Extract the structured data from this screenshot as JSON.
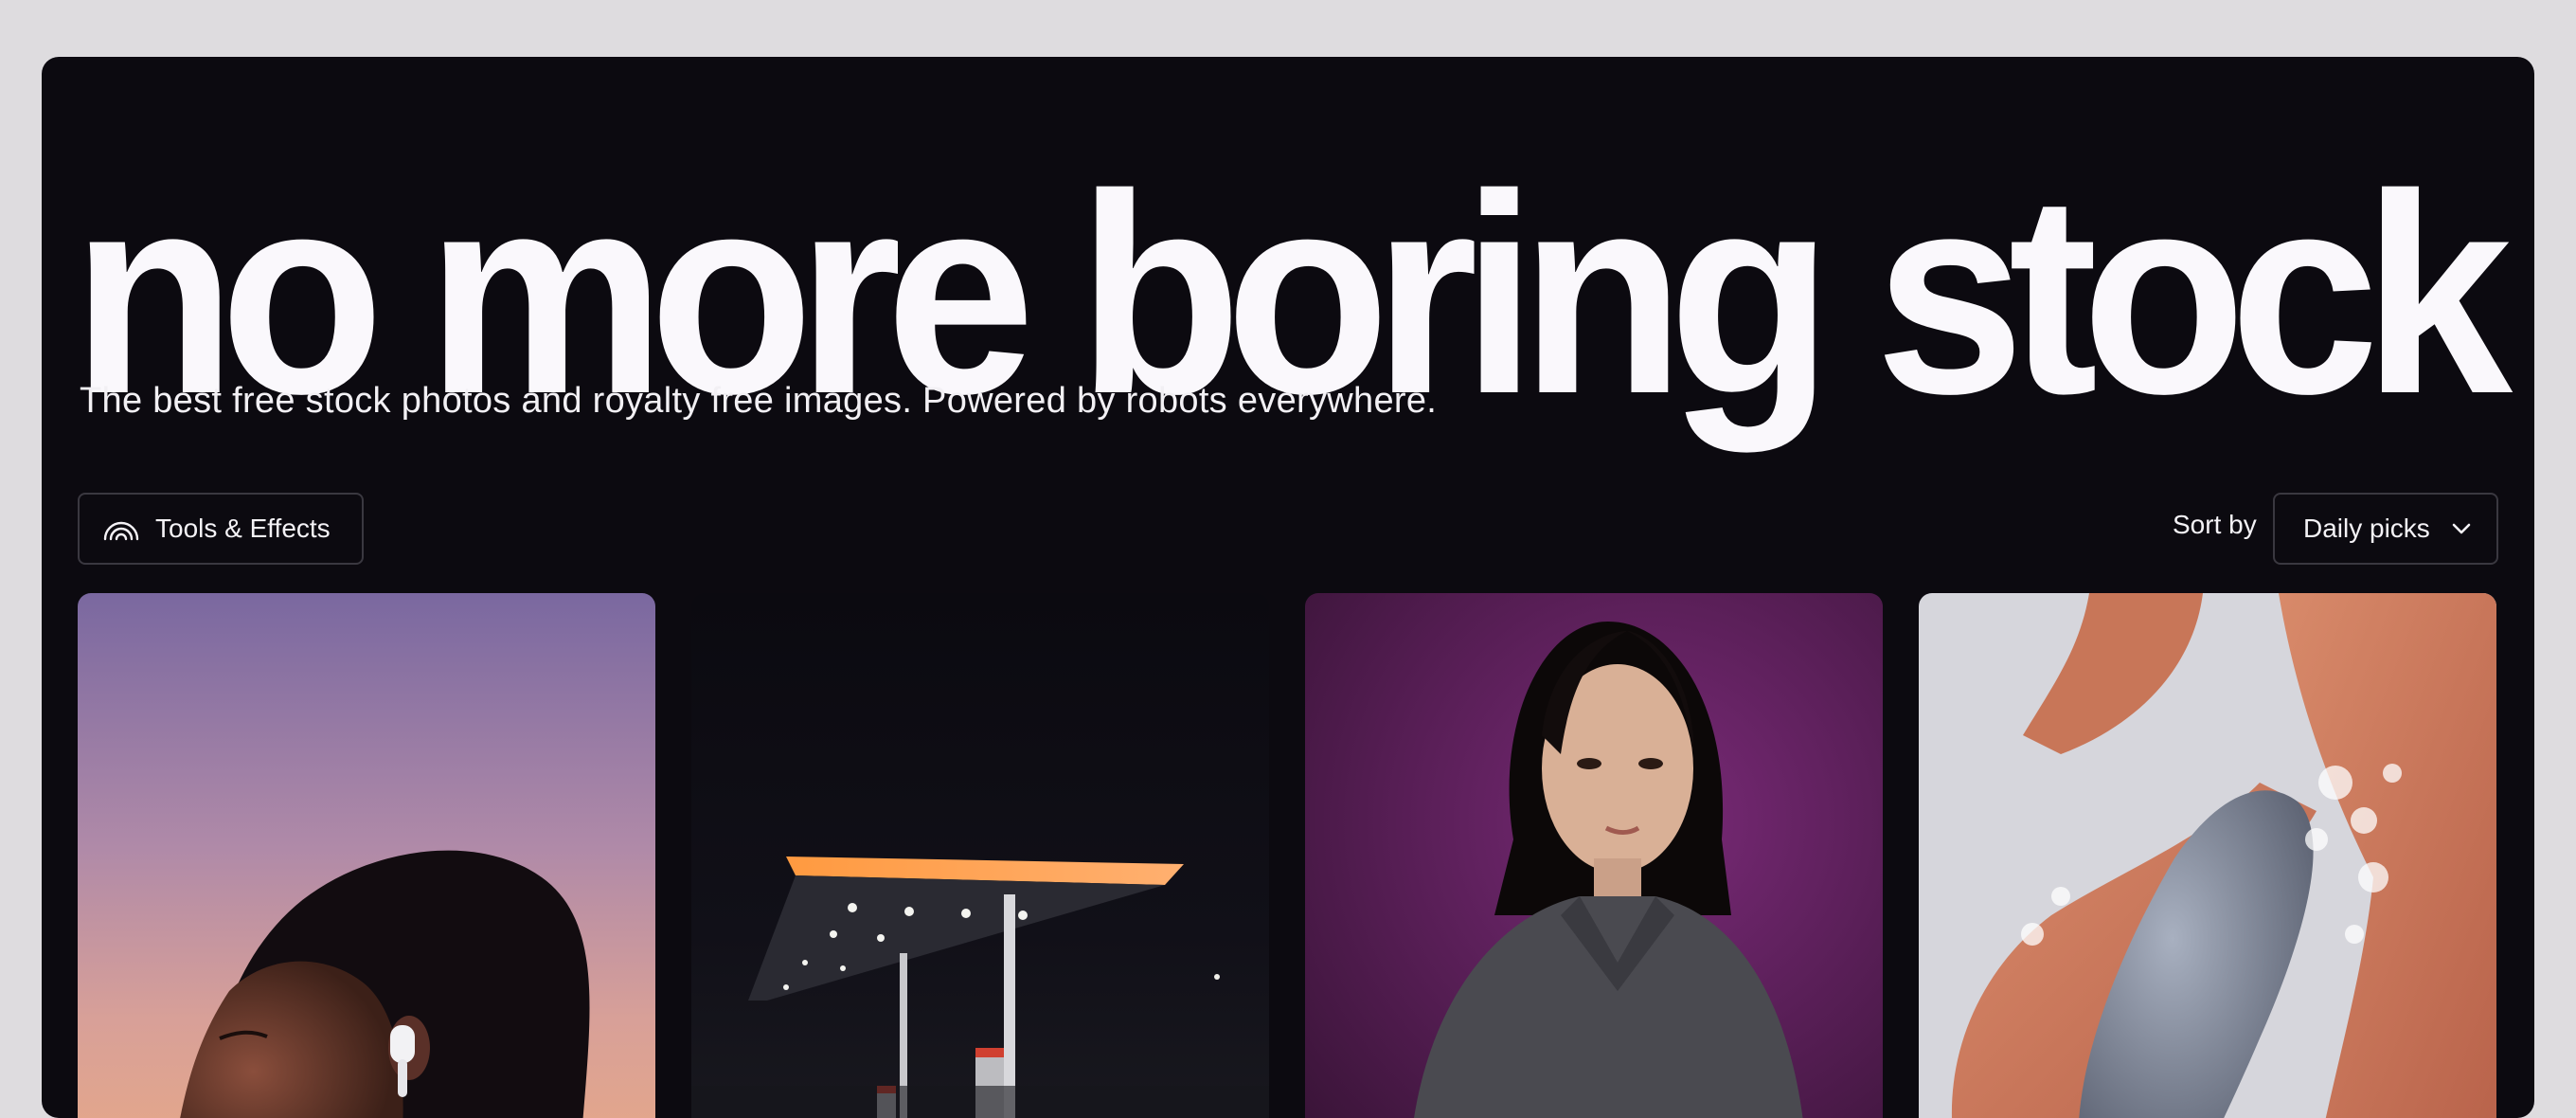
{
  "hero": {
    "title": "no more boring stock",
    "subtitle": "The best free stock photos and royalty free images. Powered by robots everywhere."
  },
  "toolbar": {
    "tools_label": "Tools & Effects",
    "tools_icon": "rainbow-icon",
    "sort_label": "Sort by",
    "sort_value": "Daily picks",
    "sort_icon": "chevron-down-icon"
  },
  "photos": [
    {
      "subject": "woman-with-earbuds"
    },
    {
      "subject": "gas-station-at-night"
    },
    {
      "subject": "woman-on-purple-background"
    },
    {
      "subject": "hands-with-soap"
    }
  ],
  "colors": {
    "background": "#dedcdf",
    "panel": "#0c0a10",
    "text": "#faf8fc",
    "border": "#3a3840"
  }
}
